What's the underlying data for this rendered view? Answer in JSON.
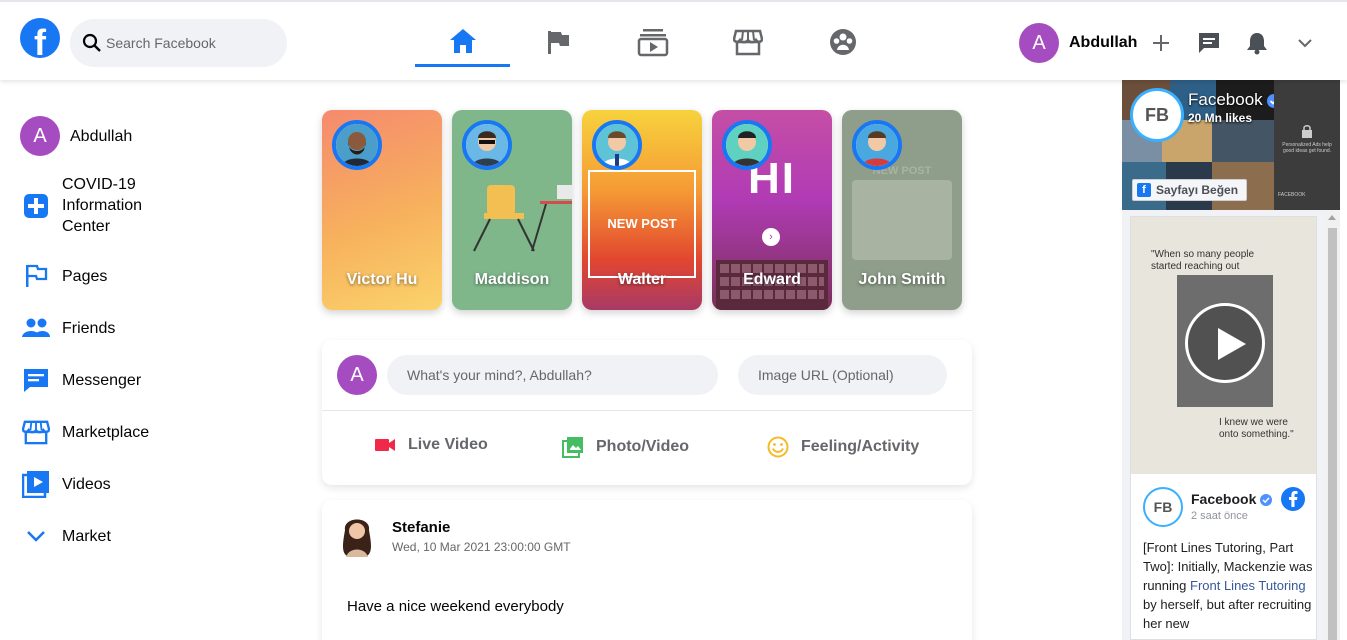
{
  "header": {
    "logo": "f",
    "search_placeholder": "Search Facebook",
    "tabs": [
      "home",
      "pages",
      "watch",
      "marketplace",
      "groups"
    ],
    "active_tab": "home",
    "user": {
      "initial": "A",
      "name": "Abdullah"
    },
    "icons": [
      "plus-icon",
      "messenger-icon",
      "bell-icon",
      "chevron-down-icon"
    ]
  },
  "sidebar": {
    "profile": {
      "initial": "A",
      "name": "Abdullah"
    },
    "items": [
      {
        "label": "COVID-19 Information Center",
        "icon": "plus-square-icon"
      },
      {
        "label": "Pages",
        "icon": "flag-icon"
      },
      {
        "label": "Friends",
        "icon": "friends-icon"
      },
      {
        "label": "Messenger",
        "icon": "chat-icon"
      },
      {
        "label": "Marketplace",
        "icon": "store-icon"
      },
      {
        "label": "Videos",
        "icon": "video-icon"
      },
      {
        "label": "Market",
        "icon": "chevron-down-icon"
      }
    ]
  },
  "stories": [
    {
      "name": "Victor Hu",
      "overlay": ""
    },
    {
      "name": "Maddison",
      "overlay": ""
    },
    {
      "name": "Walter",
      "overlay": "NEW POST"
    },
    {
      "name": "Edward",
      "overlay": "HI"
    },
    {
      "name": "John Smith",
      "overlay": "NEW POST"
    }
  ],
  "composer": {
    "initial": "A",
    "status_placeholder": "What's your mind?, Abdullah?",
    "image_placeholder": "Image URL (Optional)",
    "actions": [
      "Live Video",
      "Photo/Video",
      "Feeling/Activity"
    ]
  },
  "post": {
    "author": "Stefanie",
    "time": "Wed, 10 Mar 2021 23:00:00 GMT",
    "text": "Have a nice weekend everybody"
  },
  "page_widget": {
    "logo": "FB",
    "name": "Facebook",
    "likes": "20 Mn likes",
    "like_button": "Sayfayı Beğen",
    "ad_text": "Personalized Ads help good ideas get found.",
    "ad_brand": "FACEBOOK",
    "video_quote_top": "\"When so many people started reaching out",
    "video_quote_bottom": "I knew we were onto something.\"",
    "feed_name": "Facebook",
    "feed_time": "2 saat önce",
    "feed_text_1": "[Front Lines Tutoring, Part Two]: Initially, Mackenzie was running",
    "feed_link": "Front Lines Tutoring",
    "feed_text_2": "by herself, but after recruiting her new"
  },
  "colors": {
    "brand": "#1877f2",
    "avatar": "#a54cc0",
    "background": "#f0f2f5"
  }
}
